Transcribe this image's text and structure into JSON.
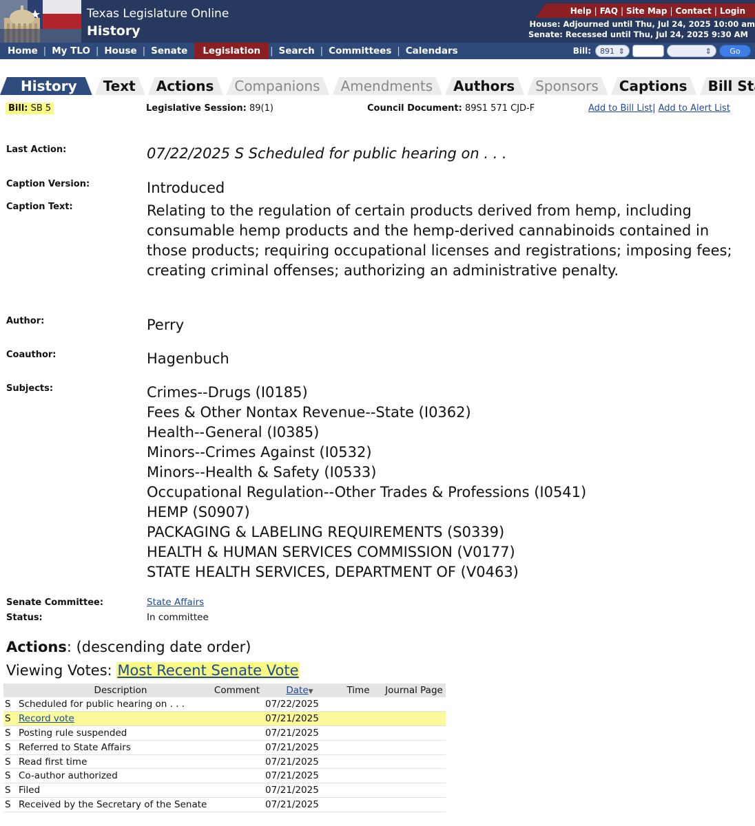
{
  "header": {
    "site_title": "Texas Legislature Online",
    "page_heading": "History",
    "utility_links": [
      "Help",
      "FAQ",
      "Site Map",
      "Contact",
      "Login"
    ],
    "house_status": "House: Adjourned until Thu, Jul 24, 2025 10:00 am",
    "senate_status": "Senate: Recessed until Thu, Jul 24, 2025 9:30 AM"
  },
  "nav": {
    "home": "Home",
    "my_tlo": "My TLO",
    "house": "House",
    "senate": "Senate",
    "legislation": "Legislation",
    "search": "Search",
    "committees": "Committees",
    "calendars": "Calendars",
    "bill_lookup_label": "Bill:",
    "session_value": "891",
    "go_label": "Go"
  },
  "tabs": [
    {
      "label": "History",
      "state": "active"
    },
    {
      "label": "Text",
      "state": "on"
    },
    {
      "label": "Actions",
      "state": "on"
    },
    {
      "label": "Companions",
      "state": "off"
    },
    {
      "label": "Amendments",
      "state": "off"
    },
    {
      "label": "Authors",
      "state": "on"
    },
    {
      "label": "Sponsors",
      "state": "off"
    },
    {
      "label": "Captions",
      "state": "on"
    },
    {
      "label": "Bill Stages",
      "state": "on"
    }
  ],
  "bill": {
    "label": "Bill:",
    "number": "SB 5",
    "session_label": "Legislative Session:",
    "session": "89(1)",
    "council_label": "Council Document:",
    "council_document": "89S1 571 CJD-F",
    "add_to_bill_list": "Add to Bill List",
    "add_to_alert_list": "Add to Alert List"
  },
  "details": {
    "last_action_label": "Last Action:",
    "last_action": "07/22/2025 S Scheduled for public hearing on . . .",
    "caption_version_label": "Caption Version:",
    "caption_version": "Introduced",
    "caption_text_label": "Caption Text:",
    "caption_text": "Relating to the regulation of certain products derived from hemp, including consumable hemp products and the hemp-derived cannabinoids contained in those products; requiring occupational licenses and registrations; imposing fees; creating criminal offenses; authorizing an administrative penalty.",
    "author_label": "Author:",
    "author": "Perry",
    "coauthor_label": "Coauthor:",
    "coauthor": "Hagenbuch",
    "subjects_label": "Subjects:",
    "subjects": [
      "Crimes--Drugs (I0185)",
      "Fees & Other Nontax Revenue--State (I0362)",
      "Health--General (I0385)",
      "Minors--Crimes Against (I0532)",
      "Minors--Health & Safety (I0533)",
      "Occupational Regulation--Other Trades & Professions (I0541)",
      "HEMP (S0907)",
      "PACKAGING & LABELING REQUIREMENTS (S0339)",
      "HEALTH & HUMAN SERVICES COMMISSION (V0177)",
      "STATE HEALTH SERVICES, DEPARTMENT OF (V0463)"
    ],
    "senate_committee_label": "Senate Committee:",
    "senate_committee": "State Affairs",
    "status_label": "Status:",
    "status": "In committee"
  },
  "actions": {
    "heading": "Actions",
    "heading_suffix": ": (descending date order)",
    "viewing_votes_label": "Viewing Votes:",
    "most_recent_vote": "Most Recent Senate Vote",
    "columns": {
      "description": "Description",
      "comment": "Comment",
      "date": "Date",
      "time": "Time",
      "journal_page": "Journal Page"
    },
    "rows": [
      {
        "chamber": "S",
        "description": "Scheduled for public hearing on . . .",
        "date": "07/22/2025",
        "link": false,
        "highlight": false
      },
      {
        "chamber": "S",
        "description": "Record vote",
        "date": "07/21/2025",
        "link": true,
        "highlight": true
      },
      {
        "chamber": "S",
        "description": "Posting rule suspended",
        "date": "07/21/2025",
        "link": false,
        "highlight": false
      },
      {
        "chamber": "S",
        "description": "Referred to State Affairs",
        "date": "07/21/2025",
        "link": false,
        "highlight": false
      },
      {
        "chamber": "S",
        "description": "Read first time",
        "date": "07/21/2025",
        "link": false,
        "highlight": false
      },
      {
        "chamber": "S",
        "description": "Co-author authorized",
        "date": "07/21/2025",
        "link": false,
        "highlight": false
      },
      {
        "chamber": "S",
        "description": "Filed",
        "date": "07/21/2025",
        "link": false,
        "highlight": false
      },
      {
        "chamber": "S",
        "description": "Received by the Secretary of the Senate",
        "date": "07/21/2025",
        "link": false,
        "highlight": false
      }
    ]
  },
  "colors": {
    "header_navy": "#27395e",
    "nav_blue": "#2d4a7a",
    "accent_red": "#8b1f23",
    "highlight_yellow": "#fafa82",
    "link_blue": "#1a4a9c"
  }
}
